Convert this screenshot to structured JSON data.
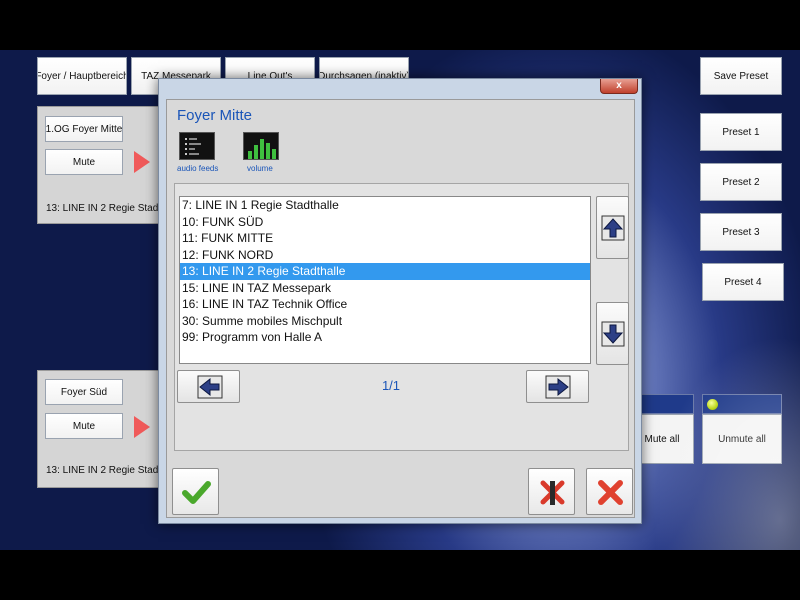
{
  "top_tabs": [
    "Foyer / Hauptbereich",
    "TAZ Messepark",
    "Line Out's",
    "Durchsagen (inaktiv)"
  ],
  "presets": {
    "save": "Save Preset",
    "items": [
      "Preset 1",
      "Preset 2",
      "Preset 3",
      "Preset 4"
    ]
  },
  "zone_top": {
    "name": "1.OG Foyer Mitte",
    "mute_label": "Mute",
    "source": "13: LINE IN 2 Regie Stadthalle"
  },
  "zone_bottom": {
    "name": "Foyer Süd",
    "mute_label": "Mute",
    "source": "13: LINE IN 2 Regie Stadthalle"
  },
  "mute_all": "Mute all",
  "unmute_all": "Unmute all",
  "dialog": {
    "close_glyph": "x",
    "title": "Foyer Mitte",
    "tabs": [
      {
        "label": "audio feeds",
        "icon": "audio-feeds-icon"
      },
      {
        "label": "volume",
        "icon": "volume-bars-icon"
      }
    ],
    "sources": [
      "7: LINE IN 1 Regie Stadthalle",
      "10: FUNK SÜD",
      "11: FUNK MITTE",
      "12: FUNK NORD",
      "13: LINE IN 2 Regie Stadthalle",
      "15: LINE IN TAZ Messepark",
      "16: LINE IN TAZ Technik Office",
      "30: Summe mobiles Mischpult",
      "99: Programm von Halle A"
    ],
    "selected_index": 4,
    "page": "1/1"
  },
  "colors": {
    "accent": "#1a55b8",
    "selection": "#3399ee",
    "arrow": "#f05a5a",
    "led": "#b9d60c"
  }
}
